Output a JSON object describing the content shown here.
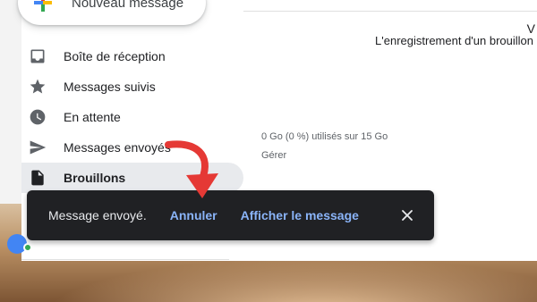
{
  "compose": {
    "label": "Nouveau message"
  },
  "sidebar": {
    "items": [
      {
        "label": "Boîte de réception",
        "icon": "inbox-icon",
        "active": false
      },
      {
        "label": "Messages suivis",
        "icon": "star-icon",
        "active": false
      },
      {
        "label": "En attente",
        "icon": "clock-icon",
        "active": false
      },
      {
        "label": "Messages envoyés",
        "icon": "send-icon",
        "active": false
      },
      {
        "label": "Brouillons",
        "icon": "draft-icon",
        "active": true
      }
    ]
  },
  "main": {
    "truncated_header": "V",
    "draft_notice": "L'enregistrement d'un brouillon",
    "storage": "0 Go (0 %) utilisés sur 15 Go",
    "manage": "Gérer"
  },
  "snackbar": {
    "message": "Message envoyé.",
    "undo": "Annuler",
    "view": "Afficher le message",
    "close_icon": "close-icon"
  },
  "annotation": {
    "arrow_color": "#e53935"
  },
  "colors": {
    "snackbar_bg": "#202124",
    "snackbar_link": "#8ab4f8",
    "active_item_bg": "#e8eaed"
  }
}
